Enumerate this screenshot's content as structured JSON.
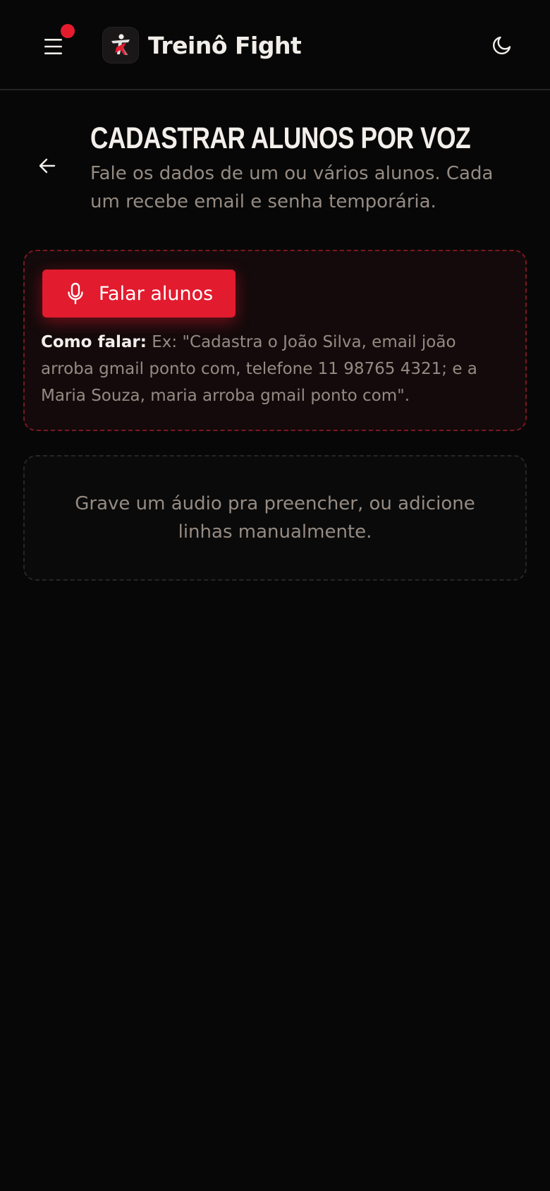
{
  "header": {
    "brand_name": "Treinô Fight",
    "menu_icon": "hamburger-menu-icon",
    "notification_dot_color": "#e51c2e",
    "theme_icon": "moon-icon"
  },
  "page": {
    "back_icon": "arrow-left-icon",
    "title": "CADASTRAR ALUNOS POR VOZ",
    "subtitle": "Fale os dados de um ou vários alunos. Cada um recebe email e senha temporária."
  },
  "voice_card": {
    "button_label": "Falar alunos",
    "button_icon": "microphone-icon",
    "hint_label": "Como falar:",
    "hint_text": " Ex: \"Cadastra o João Silva, email joão arroba gmail ponto com, telefone 11 98765 4321; e a Maria Souza, maria arroba gmail ponto com\"."
  },
  "empty_state": {
    "text": "Grave um áudio pra preencher, ou adicione linhas manualmente."
  },
  "colors": {
    "accent": "#e21b2e",
    "background": "#070707",
    "muted_text": "#958b83"
  }
}
